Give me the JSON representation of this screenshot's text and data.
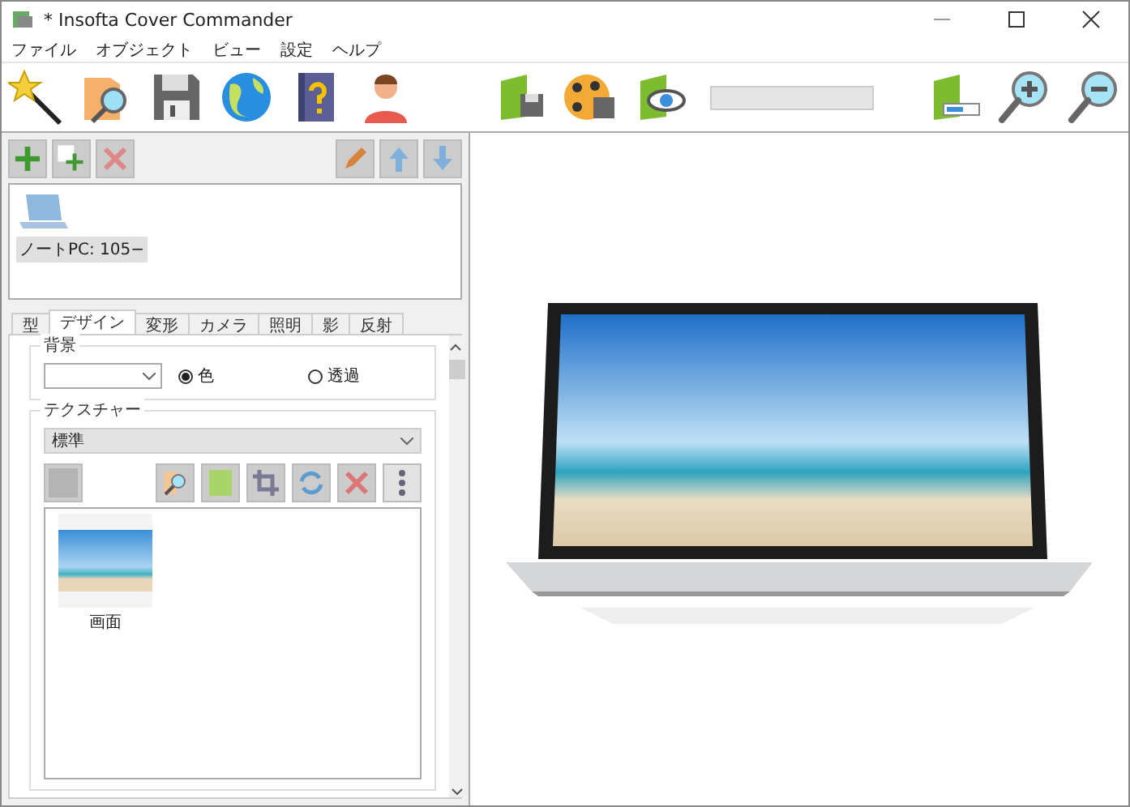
{
  "window": {
    "title": "* Insofta Cover Commander"
  },
  "menu": [
    "ファイル",
    "オブジェクト",
    "ビュー",
    "設定",
    "ヘルプ"
  ],
  "toolbar": {
    "progress": {
      "level": 0
    }
  },
  "objects": {
    "items": [
      {
        "label": "ノートPC: 105−",
        "selected": true
      }
    ]
  },
  "tabs": [
    {
      "label": "型",
      "selected": false
    },
    {
      "label": "デザイン",
      "selected": true
    },
    {
      "label": "変形",
      "selected": false
    },
    {
      "label": "カメラ",
      "selected": false
    },
    {
      "label": "照明",
      "selected": false
    },
    {
      "label": "影",
      "selected": false
    },
    {
      "label": "反射",
      "selected": false
    }
  ],
  "background": {
    "title": "背景",
    "options": [
      {
        "label": "色",
        "selected": true
      },
      {
        "label": "透過",
        "selected": false
      }
    ]
  },
  "texture": {
    "title": "テクスチャー",
    "value": "標準",
    "images": [
      {
        "label": "画面",
        "selected": false
      }
    ]
  }
}
